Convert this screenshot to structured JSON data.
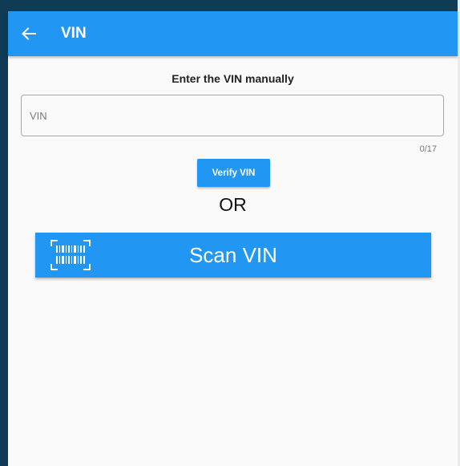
{
  "appbar": {
    "title": "VIN",
    "back_icon": "arrow-left-icon",
    "color": "#2196f3"
  },
  "main": {
    "heading": "Enter the VIN manually",
    "vin_input": {
      "placeholder": "VIN",
      "value": "",
      "counter": "0/17"
    },
    "verify_label": "Verify VIN",
    "or_text": "OR",
    "scan_label": "Scan VIN",
    "scan_icon": "barcode-scan-icon"
  }
}
